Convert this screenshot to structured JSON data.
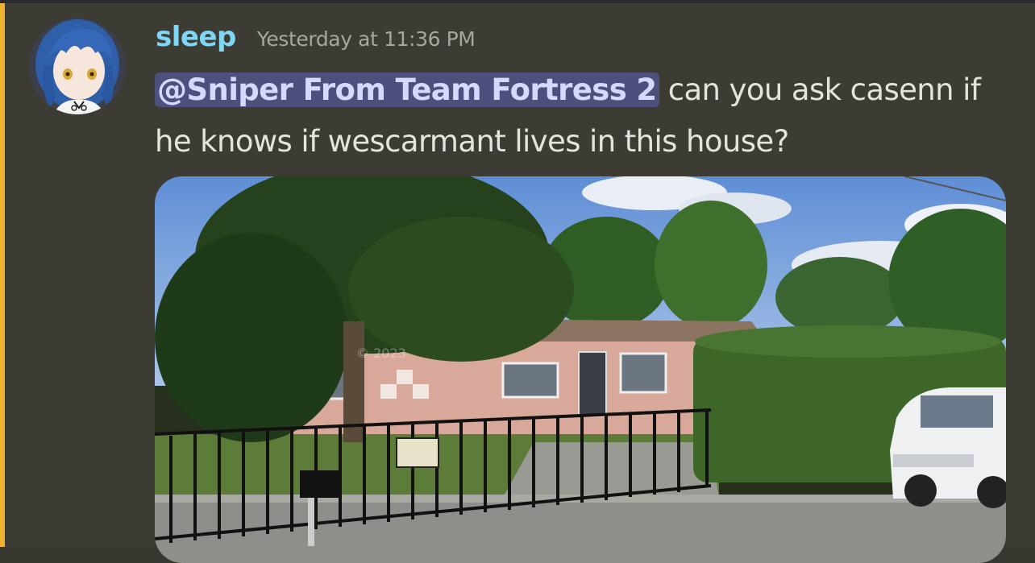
{
  "message": {
    "author": "sleep",
    "timestamp": "Yesterday at 11:36 PM",
    "mention": "@Sniper From Team Fortress 2",
    "text_after_mention": " can you ask casenn if he knows if wescarmant lives in this house?",
    "author_color": "#7fd7f5",
    "mention_bg": "#4e4f7c",
    "accent_bar_color": "#f0b232"
  },
  "attachment": {
    "type": "image",
    "description_icon": "photo-icon",
    "watermark": "© 2023"
  }
}
